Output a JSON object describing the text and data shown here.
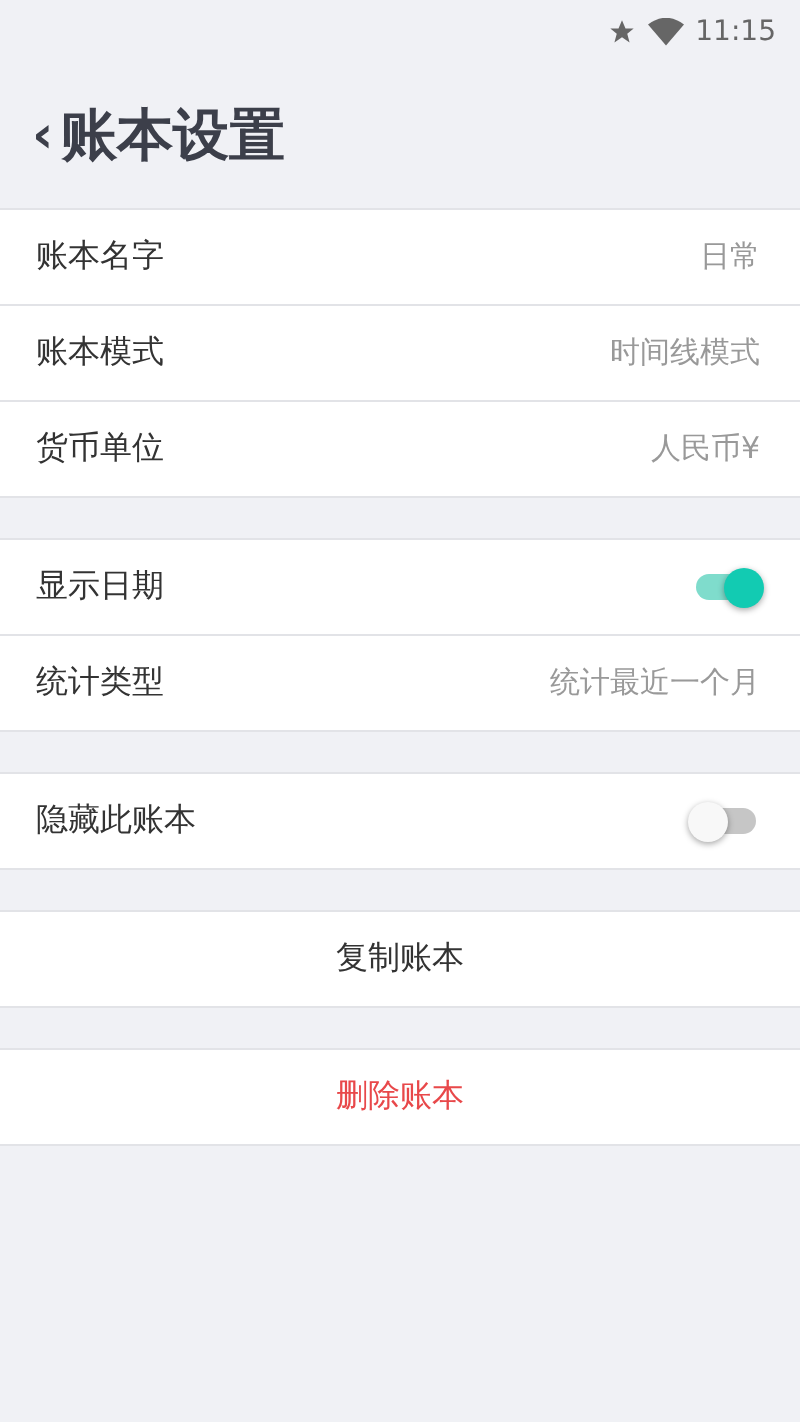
{
  "status_bar": {
    "time": "11:15"
  },
  "header": {
    "back": "‹",
    "title": "账本设置"
  },
  "sections": [
    {
      "rows": [
        {
          "kind": "value",
          "label": "账本名字",
          "value": "日常"
        },
        {
          "kind": "value",
          "label": "账本模式",
          "value": "时间线模式"
        },
        {
          "kind": "value",
          "label": "货币单位",
          "value": "人民币¥"
        }
      ]
    },
    {
      "rows": [
        {
          "kind": "toggle",
          "label": "显示日期",
          "on": true
        },
        {
          "kind": "value",
          "label": "统计类型",
          "value": "统计最近一个月"
        }
      ]
    },
    {
      "rows": [
        {
          "kind": "toggle",
          "label": "隐藏此账本",
          "on": false
        }
      ]
    },
    {
      "rows": [
        {
          "kind": "action",
          "label": "复制账本"
        }
      ]
    },
    {
      "rows": [
        {
          "kind": "danger",
          "label": "删除账本"
        }
      ]
    }
  ]
}
